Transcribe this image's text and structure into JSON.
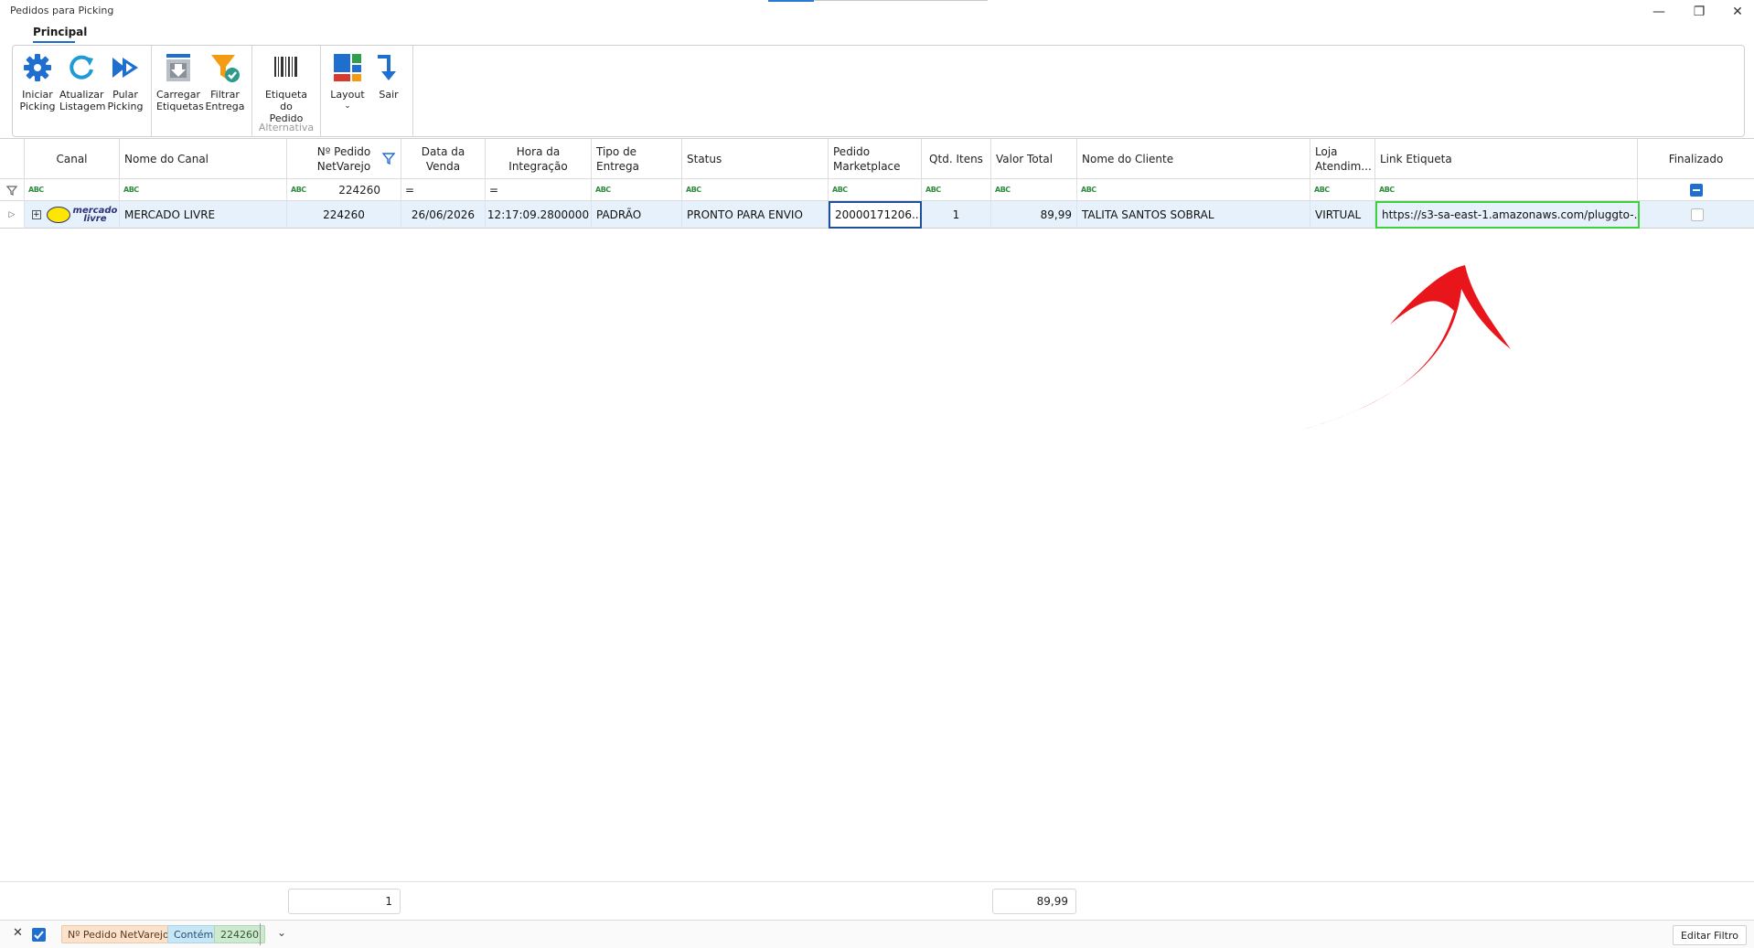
{
  "window": {
    "title": "Pedidos para Picking",
    "minimize_glyph": "—",
    "restore_glyph": "❐",
    "close_glyph": "✕"
  },
  "ribbon": {
    "tab": "Principal",
    "buttons": {
      "iniciar": "Iniciar\nPicking",
      "atualizar": "Atualizar\nListagem",
      "pular": "Pular\nPicking",
      "carregar": "Carregar\nEtiquetas",
      "filtrar": "Filtrar\nEntrega",
      "etiqueta": "Etiqueta\ndo Pedido",
      "layout": "Layout",
      "sair": "Sair"
    },
    "group_alternativa": "Alternativa",
    "colors": {
      "blue": "#1f6fd1",
      "orange": "#f39c12",
      "green": "#2ea04a",
      "red": "#d93a2b"
    }
  },
  "grid": {
    "headers": {
      "canal": "Canal",
      "nome_canal": "Nome do Canal",
      "pedido_netvarejo": "Nº Pedido\nNetVarejo",
      "data_venda": "Data da\nVenda",
      "hora_integracao": "Hora da\nIntegração",
      "tipo_entrega": "Tipo de\nEntrega",
      "status": "Status",
      "pedido_marketplace": "Pedido\nMarketplace",
      "qtd_itens": "Qtd. Itens",
      "valor_total": "Valor Total",
      "nome_cliente": "Nome do Cliente",
      "loja": "Loja\nAtendim...",
      "link": "Link Etiqueta",
      "finalizado": "Finalizado"
    },
    "filter_row": {
      "abc": "ABC",
      "pedido_value": "224260",
      "equals": "="
    },
    "rows": [
      {
        "canal_logo_text": "mercado\nlivre",
        "nome_canal": "MERCADO LIVRE",
        "pedido_netvarejo": "224260",
        "data_venda": "26/06/2026",
        "hora_integracao": "12:17:09.2800000",
        "tipo_entrega": "PADRÃO",
        "status": "PRONTO PARA ENVIO",
        "pedido_marketplace": "20000171206...",
        "qtd_itens": "1",
        "valor_total": "89,99",
        "nome_cliente": "TALITA SANTOS SOBRAL",
        "loja": "VIRTUAL",
        "link": "https://s3-sa-east-1.amazonaws.com/pluggto-...",
        "finalizado": false
      }
    ]
  },
  "summary": {
    "count": "1",
    "total": "89,99"
  },
  "filterbar": {
    "field": "Nº Pedido NetVarejo",
    "operator": "Contém",
    "value": "224260",
    "edit": "Editar Filtro"
  }
}
